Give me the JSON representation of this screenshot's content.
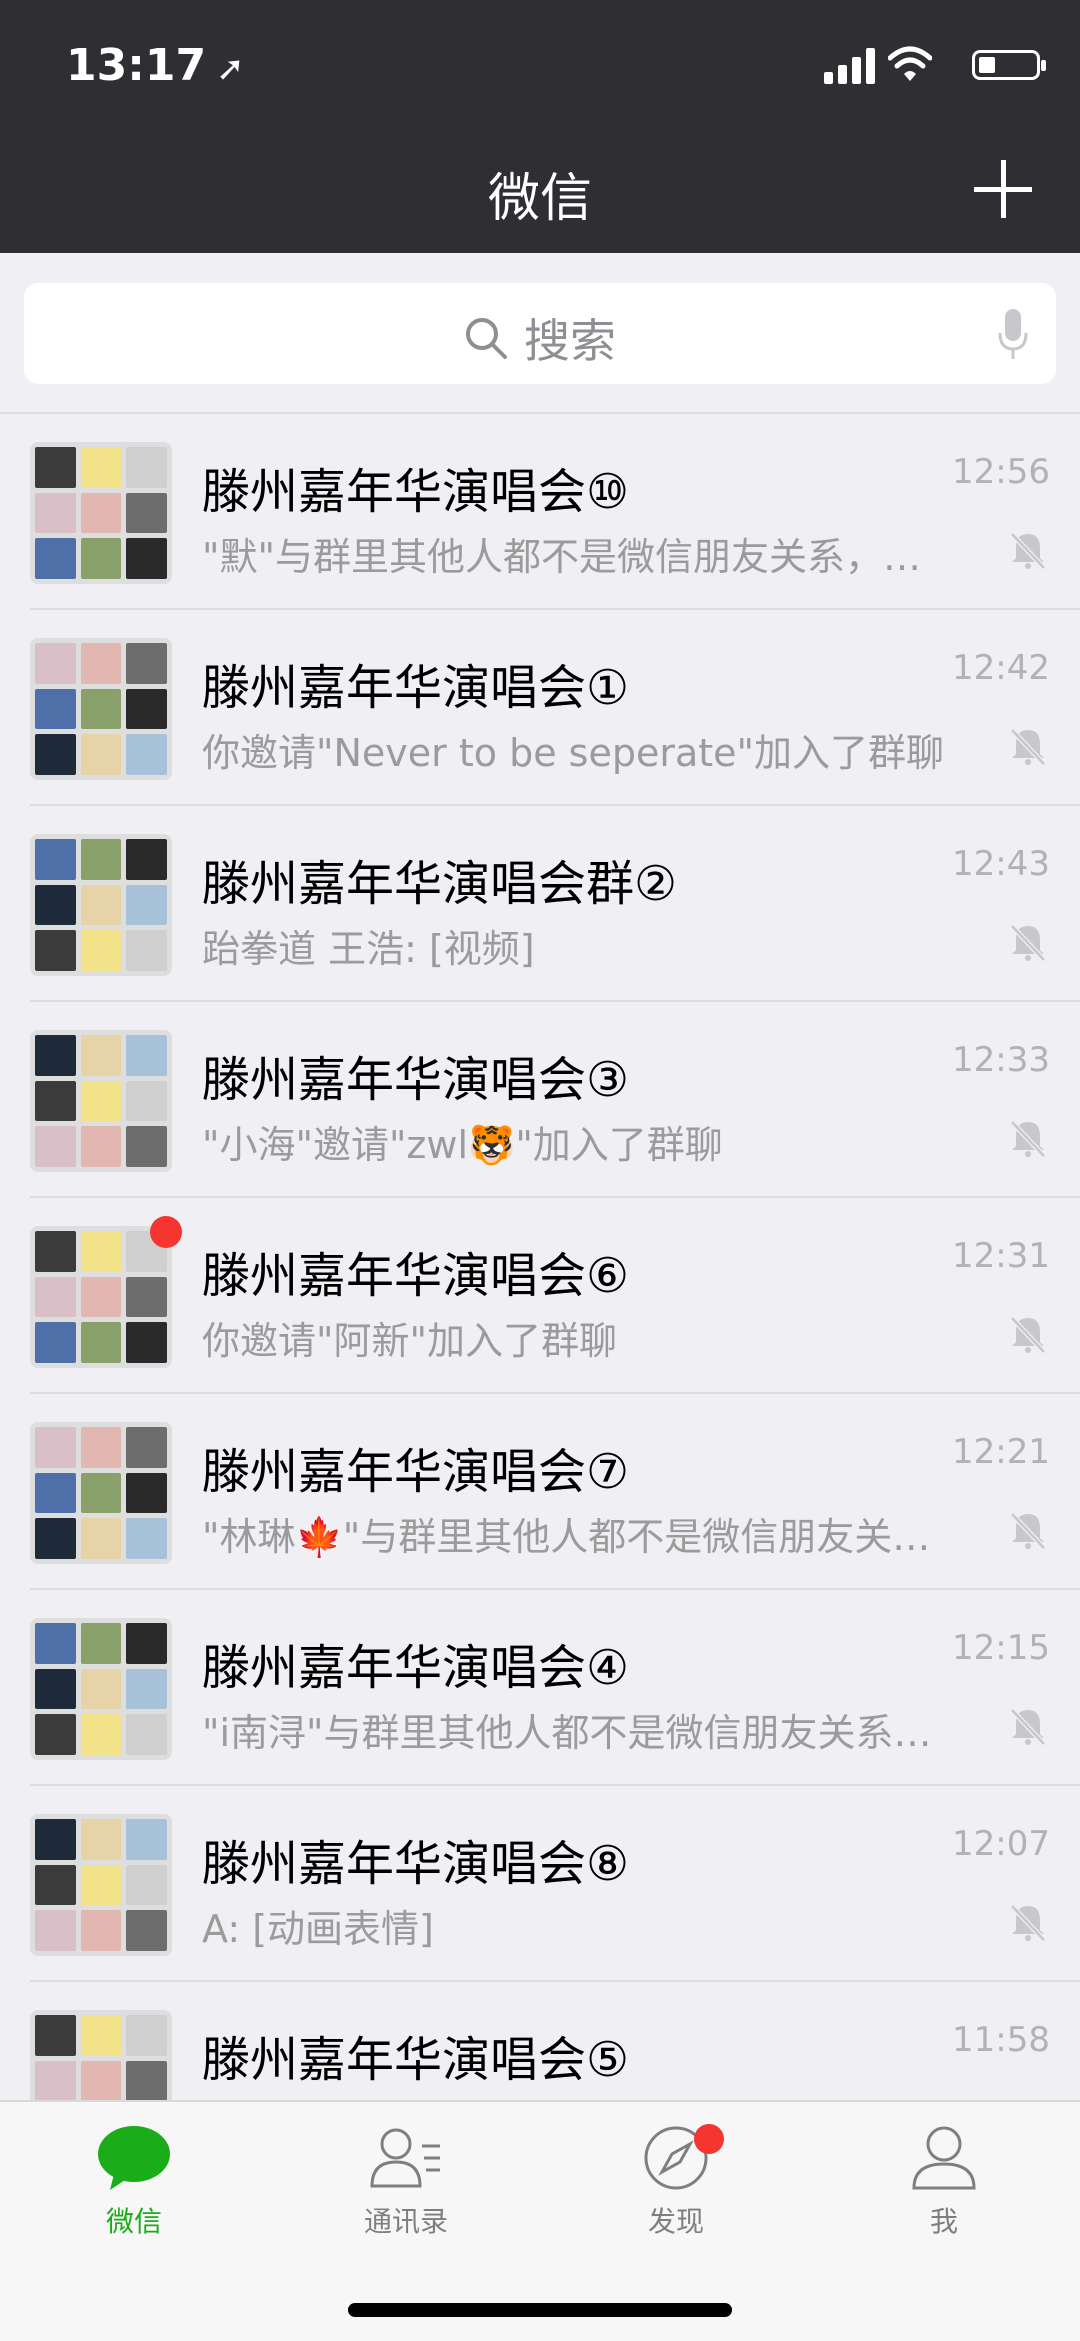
{
  "status": {
    "time": "13:17"
  },
  "header": {
    "title": "微信"
  },
  "search": {
    "placeholder": "搜索"
  },
  "chats": [
    {
      "name": "滕州嘉年华演唱会⑩",
      "message": "\"默\"与群里其他人都不是微信朋友关系，请注意隐私安全",
      "time": "12:56",
      "unread": false
    },
    {
      "name": "滕州嘉年华演唱会①",
      "message": "你邀请\"Never to be seperate\"加入了群聊",
      "time": "12:42",
      "unread": false
    },
    {
      "name": "滕州嘉年华演唱会群②",
      "message": "跆拳道 王浩: [视频]",
      "time": "12:43",
      "unread": false
    },
    {
      "name": "滕州嘉年华演唱会③",
      "message": "\"小海\"邀请\"zwl🐯\"加入了群聊",
      "time": "12:33",
      "unread": false
    },
    {
      "name": "滕州嘉年华演唱会⑥",
      "message": "你邀请\"阿新\"加入了群聊",
      "time": "12:31",
      "unread": true
    },
    {
      "name": "滕州嘉年华演唱会⑦",
      "message": "\"林琳🍁\"与群里其他人都不是微信朋友关系，请注意隐私安全",
      "time": "12:21",
      "unread": false
    },
    {
      "name": "滕州嘉年华演唱会④",
      "message": "\"i南浔\"与群里其他人都不是微信朋友关系，请注意隐私安全",
      "time": "12:15",
      "unread": false
    },
    {
      "name": "滕州嘉年华演唱会⑧",
      "message": "A: [动画表情]",
      "time": "12:07",
      "unread": false
    },
    {
      "name": "滕州嘉年华演唱会⑤",
      "message": "",
      "time": "11:58",
      "unread": false
    }
  ],
  "tabs": [
    {
      "label": "微信",
      "icon": "chat-bubble-icon",
      "active": true,
      "dot": false
    },
    {
      "label": "通讯录",
      "icon": "contacts-icon",
      "active": false,
      "dot": false
    },
    {
      "label": "发现",
      "icon": "compass-icon",
      "active": false,
      "dot": true
    },
    {
      "label": "我",
      "icon": "profile-icon",
      "active": false,
      "dot": false
    }
  ],
  "colors": {
    "header_bg": "#2e2e33",
    "accent": "#1aad19",
    "badge": "#f43530"
  }
}
